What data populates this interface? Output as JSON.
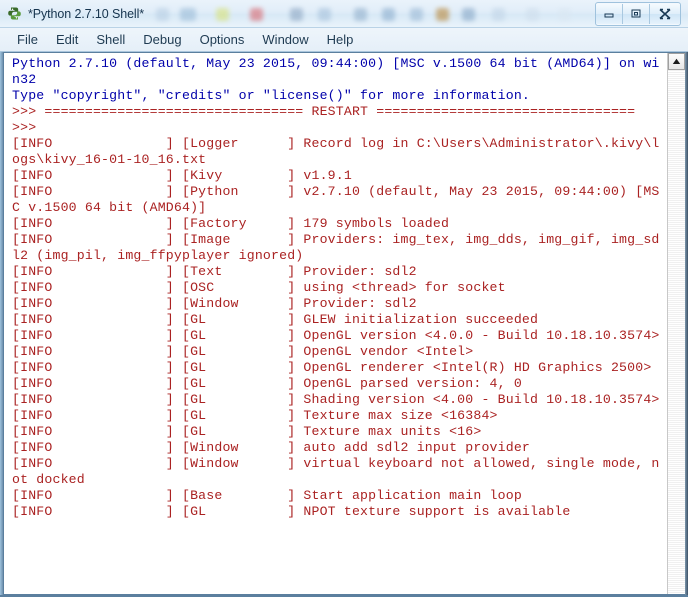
{
  "window": {
    "title": "*Python 2.7.10 Shell*",
    "app_icon": "python-snake-icon",
    "controls": {
      "minimize": "minimize-button",
      "maximize": "maximize-button",
      "close": "close-button"
    }
  },
  "menubar": {
    "items": [
      {
        "label": "File"
      },
      {
        "label": "Edit"
      },
      {
        "label": "Shell"
      },
      {
        "label": "Debug"
      },
      {
        "label": "Options"
      },
      {
        "label": "Window"
      },
      {
        "label": "Help"
      }
    ]
  },
  "colors": {
    "banner_text": "#0000aa",
    "log_text": "#aa2222",
    "terminal_background": "#ffffff",
    "titlebar_text": "#16344e"
  },
  "scrollbar": {
    "up_arrow": "scroll-up-arrow-icon",
    "visible": true
  },
  "shell": {
    "lines": [
      {
        "color": "banner",
        "text": "Python 2.7.10 (default, May 23 2015, 09:44:00) [MSC v.1500 64 bit (AMD64)] on wi"
      },
      {
        "color": "banner",
        "text": "n32"
      },
      {
        "color": "banner",
        "text": "Type \"copyright\", \"credits\" or \"license()\" for more information."
      },
      {
        "color": "log",
        "text": ">>> ================================ RESTART ================================"
      },
      {
        "color": "log",
        "text": ">>> "
      },
      {
        "color": "log",
        "text": "[INFO              ] [Logger      ] Record log in C:\\Users\\Administrator\\.kivy\\l"
      },
      {
        "color": "log",
        "text": "ogs\\kivy_16-01-10_16.txt"
      },
      {
        "color": "log",
        "text": "[INFO              ] [Kivy        ] v1.9.1"
      },
      {
        "color": "log",
        "text": "[INFO              ] [Python      ] v2.7.10 (default, May 23 2015, 09:44:00) [MS"
      },
      {
        "color": "log",
        "text": "C v.1500 64 bit (AMD64)]"
      },
      {
        "color": "log",
        "text": "[INFO              ] [Factory     ] 179 symbols loaded"
      },
      {
        "color": "log",
        "text": "[INFO              ] [Image       ] Providers: img_tex, img_dds, img_gif, img_sd"
      },
      {
        "color": "log",
        "text": "l2 (img_pil, img_ffpyplayer ignored)"
      },
      {
        "color": "log",
        "text": "[INFO              ] [Text        ] Provider: sdl2"
      },
      {
        "color": "log",
        "text": "[INFO              ] [OSC         ] using <thread> for socket"
      },
      {
        "color": "log",
        "text": "[INFO              ] [Window      ] Provider: sdl2"
      },
      {
        "color": "log",
        "text": "[INFO              ] [GL          ] GLEW initialization succeeded"
      },
      {
        "color": "log",
        "text": "[INFO              ] [GL          ] OpenGL version <4.0.0 - Build 10.18.10.3574>"
      },
      {
        "color": "log",
        "text": "[INFO              ] [GL          ] OpenGL vendor <Intel>"
      },
      {
        "color": "log",
        "text": "[INFO              ] [GL          ] OpenGL renderer <Intel(R) HD Graphics 2500>"
      },
      {
        "color": "log",
        "text": "[INFO              ] [GL          ] OpenGL parsed version: 4, 0"
      },
      {
        "color": "log",
        "text": "[INFO              ] [GL          ] Shading version <4.00 - Build 10.18.10.3574>"
      },
      {
        "color": "log",
        "text": "[INFO              ] [GL          ] Texture max size <16384>"
      },
      {
        "color": "log",
        "text": "[INFO              ] [GL          ] Texture max units <16>"
      },
      {
        "color": "log",
        "text": "[INFO              ] [Window      ] auto add sdl2 input provider"
      },
      {
        "color": "log",
        "text": "[INFO              ] [Window      ] virtual keyboard not allowed, single mode, n"
      },
      {
        "color": "log",
        "text": "ot docked"
      },
      {
        "color": "log",
        "text": "[INFO              ] [Base        ] Start application main loop"
      },
      {
        "color": "log",
        "text": "[INFO              ] [GL          ] NPOT texture support is available"
      }
    ]
  }
}
